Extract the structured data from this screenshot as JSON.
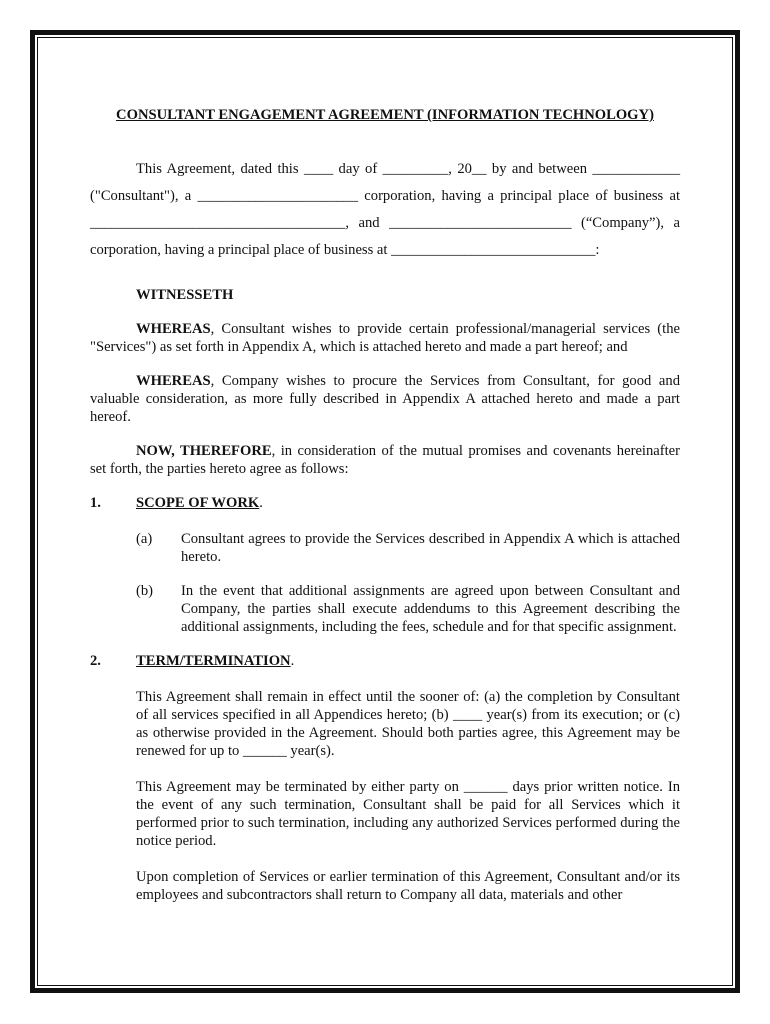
{
  "document": {
    "title": "CONSULTANT ENGAGEMENT AGREEMENT (INFORMATION TECHNOLOGY)",
    "intro": "This Agreement, dated this ____ day of _________, 20__ by and between ____________ (\"Consultant\"), a ______________________ corporation, having a principal place of business at ___________________________________, and _________________________ (“Company”), a corporation, having a principal place of business at ____________________________:",
    "witnesseth": "WITNESSETH",
    "whereas1": {
      "lead": "WHEREAS",
      "text": ", Consultant wishes to provide certain professional/managerial services (the \"Services\") as set forth in Appendix A, which is attached hereto and made a part hereof; and"
    },
    "whereas2": {
      "lead": "WHEREAS",
      "text": ", Company wishes to procure the Services from Consultant, for good and valuable consideration, as more fully described in Appendix A attached hereto and made a part hereof."
    },
    "now_therefore": {
      "lead": "NOW, THEREFORE",
      "text": ", in consideration of the mutual promises and covenants hereinafter set forth, the parties hereto agree as follows:"
    },
    "sections": [
      {
        "number": "1.",
        "heading": "SCOPE OF WORK",
        "items": [
          {
            "label": "(a)",
            "text": "Consultant agrees to provide the Services described in Appendix A which is attached hereto."
          },
          {
            "label": "(b)",
            "text": "In the event that additional assignments are agreed upon between Consultant and Company, the parties shall execute addendums to this Agreement describing the additional assignments, including the fees, schedule and for that specific assignment."
          }
        ]
      },
      {
        "number": "2.",
        "heading": "TERM/TERMINATION",
        "paragraphs": [
          "This Agreement shall remain in effect until the sooner of: (a) the completion by Consultant of all services specified in all Appendices hereto; (b) ____ year(s) from its execution; or (c) as otherwise provided in the Agreement.  Should both parties agree, this Agreement may be renewed for up to ______ year(s).",
          "This Agreement may be terminated by either party on ______ days prior written notice. In the event of any such termination, Consultant shall be paid for all Services which it performed prior to such termination, including any authorized Services performed during the notice period.",
          "Upon completion of Services or earlier termination of this Agreement, Consultant and/or its employees and subcontractors shall return to Company all data, materials and other"
        ]
      }
    ],
    "period": "."
  }
}
